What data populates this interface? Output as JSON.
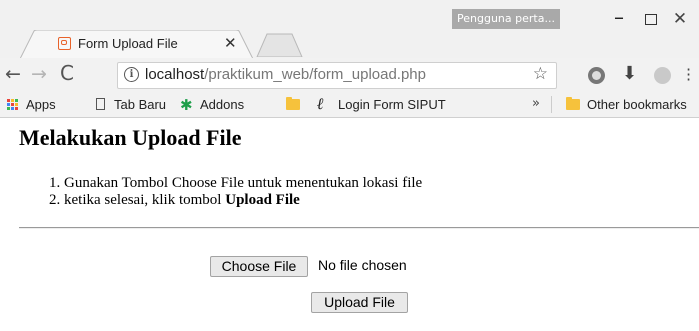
{
  "window": {
    "profile_label": "Pengguna perta...",
    "minimize_glyph": "–",
    "close_glyph": "✕"
  },
  "tab": {
    "title": "Form Upload File",
    "close_glyph": "✕",
    "favicon": "form-favicon"
  },
  "toolbar": {
    "back_glyph": "←",
    "forward_glyph": "→",
    "reload_glyph": "C",
    "info_glyph": "i",
    "url_host": "localhost",
    "url_path": "/praktikum_web/form_upload.php",
    "star_glyph": "☆",
    "download_glyph": "⬇",
    "menu_glyph": "⋮"
  },
  "bookmarks": {
    "apps": "Apps",
    "items": [
      "Tab Baru",
      "Addons",
      "",
      "Login Form SIPUT"
    ],
    "more": "»",
    "other": "Other bookmarks"
  },
  "page": {
    "title": "Melakukan Upload File",
    "steps": [
      {
        "number": "1.",
        "text": "Gunakan Tombol Choose File untuk menentukan lokasi file"
      },
      {
        "number": "2.",
        "text": "ketika selesai, klik tombol ",
        "bold": "Upload File"
      }
    ],
    "choose_file_label": "Choose File",
    "no_file_text": "No file chosen",
    "upload_label": "Upload File"
  },
  "colors": {
    "chrome_bg": "#f1f1f1",
    "favicon_orange": "#e8622a",
    "folder_yellow": "#f6c23c",
    "addons_green": "#1e9e4a"
  }
}
